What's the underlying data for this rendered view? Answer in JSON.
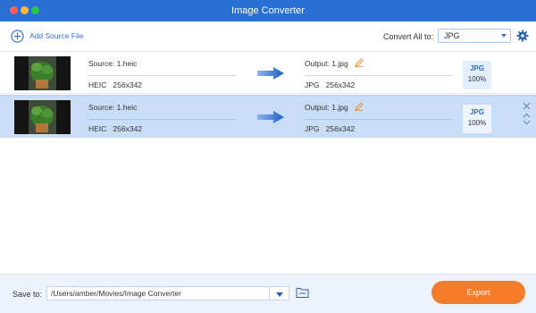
{
  "window": {
    "title": "Image Converter"
  },
  "toolbar": {
    "add_source_label": "Add Source File",
    "convert_all_label": "Convert All to:",
    "convert_all_value": "JPG"
  },
  "files": [
    {
      "source_name": "Source: 1.heic",
      "source_format": "HEIC",
      "source_dimensions": "256x342",
      "output_name": "Output: 1.jpg",
      "output_format": "JPG",
      "output_dimensions": "256x342",
      "badge_format": "JPG",
      "badge_quality": "100%",
      "selected": false
    },
    {
      "source_name": "Source: 1.heic",
      "source_format": "HEIC",
      "source_dimensions": "256x342",
      "output_name": "Output: 1.jpg",
      "output_format": "JPG",
      "output_dimensions": "256x342",
      "badge_format": "JPG",
      "badge_quality": "100%",
      "selected": true
    }
  ],
  "footer": {
    "save_to_label": "Save to:",
    "save_path": "/Users/amber/Movies/Image Converter",
    "export_label": "Export"
  },
  "colors": {
    "titlebar": "#2a6fd3",
    "accent": "#2c6fd2",
    "selected_row": "#c9ddf7",
    "export_button": "#f47b2a"
  },
  "icons": {
    "window_controls": [
      "close-dot",
      "minimize-dot",
      "maximize-dot"
    ],
    "add": "plus-circle-icon",
    "settings": "gear-icon",
    "convert": "arrow-right-icon",
    "edit": "pencil-icon",
    "remove": "close-icon",
    "move_up": "chevron-up-icon",
    "move_down": "chevron-down-icon",
    "folder": "folder-icon"
  }
}
